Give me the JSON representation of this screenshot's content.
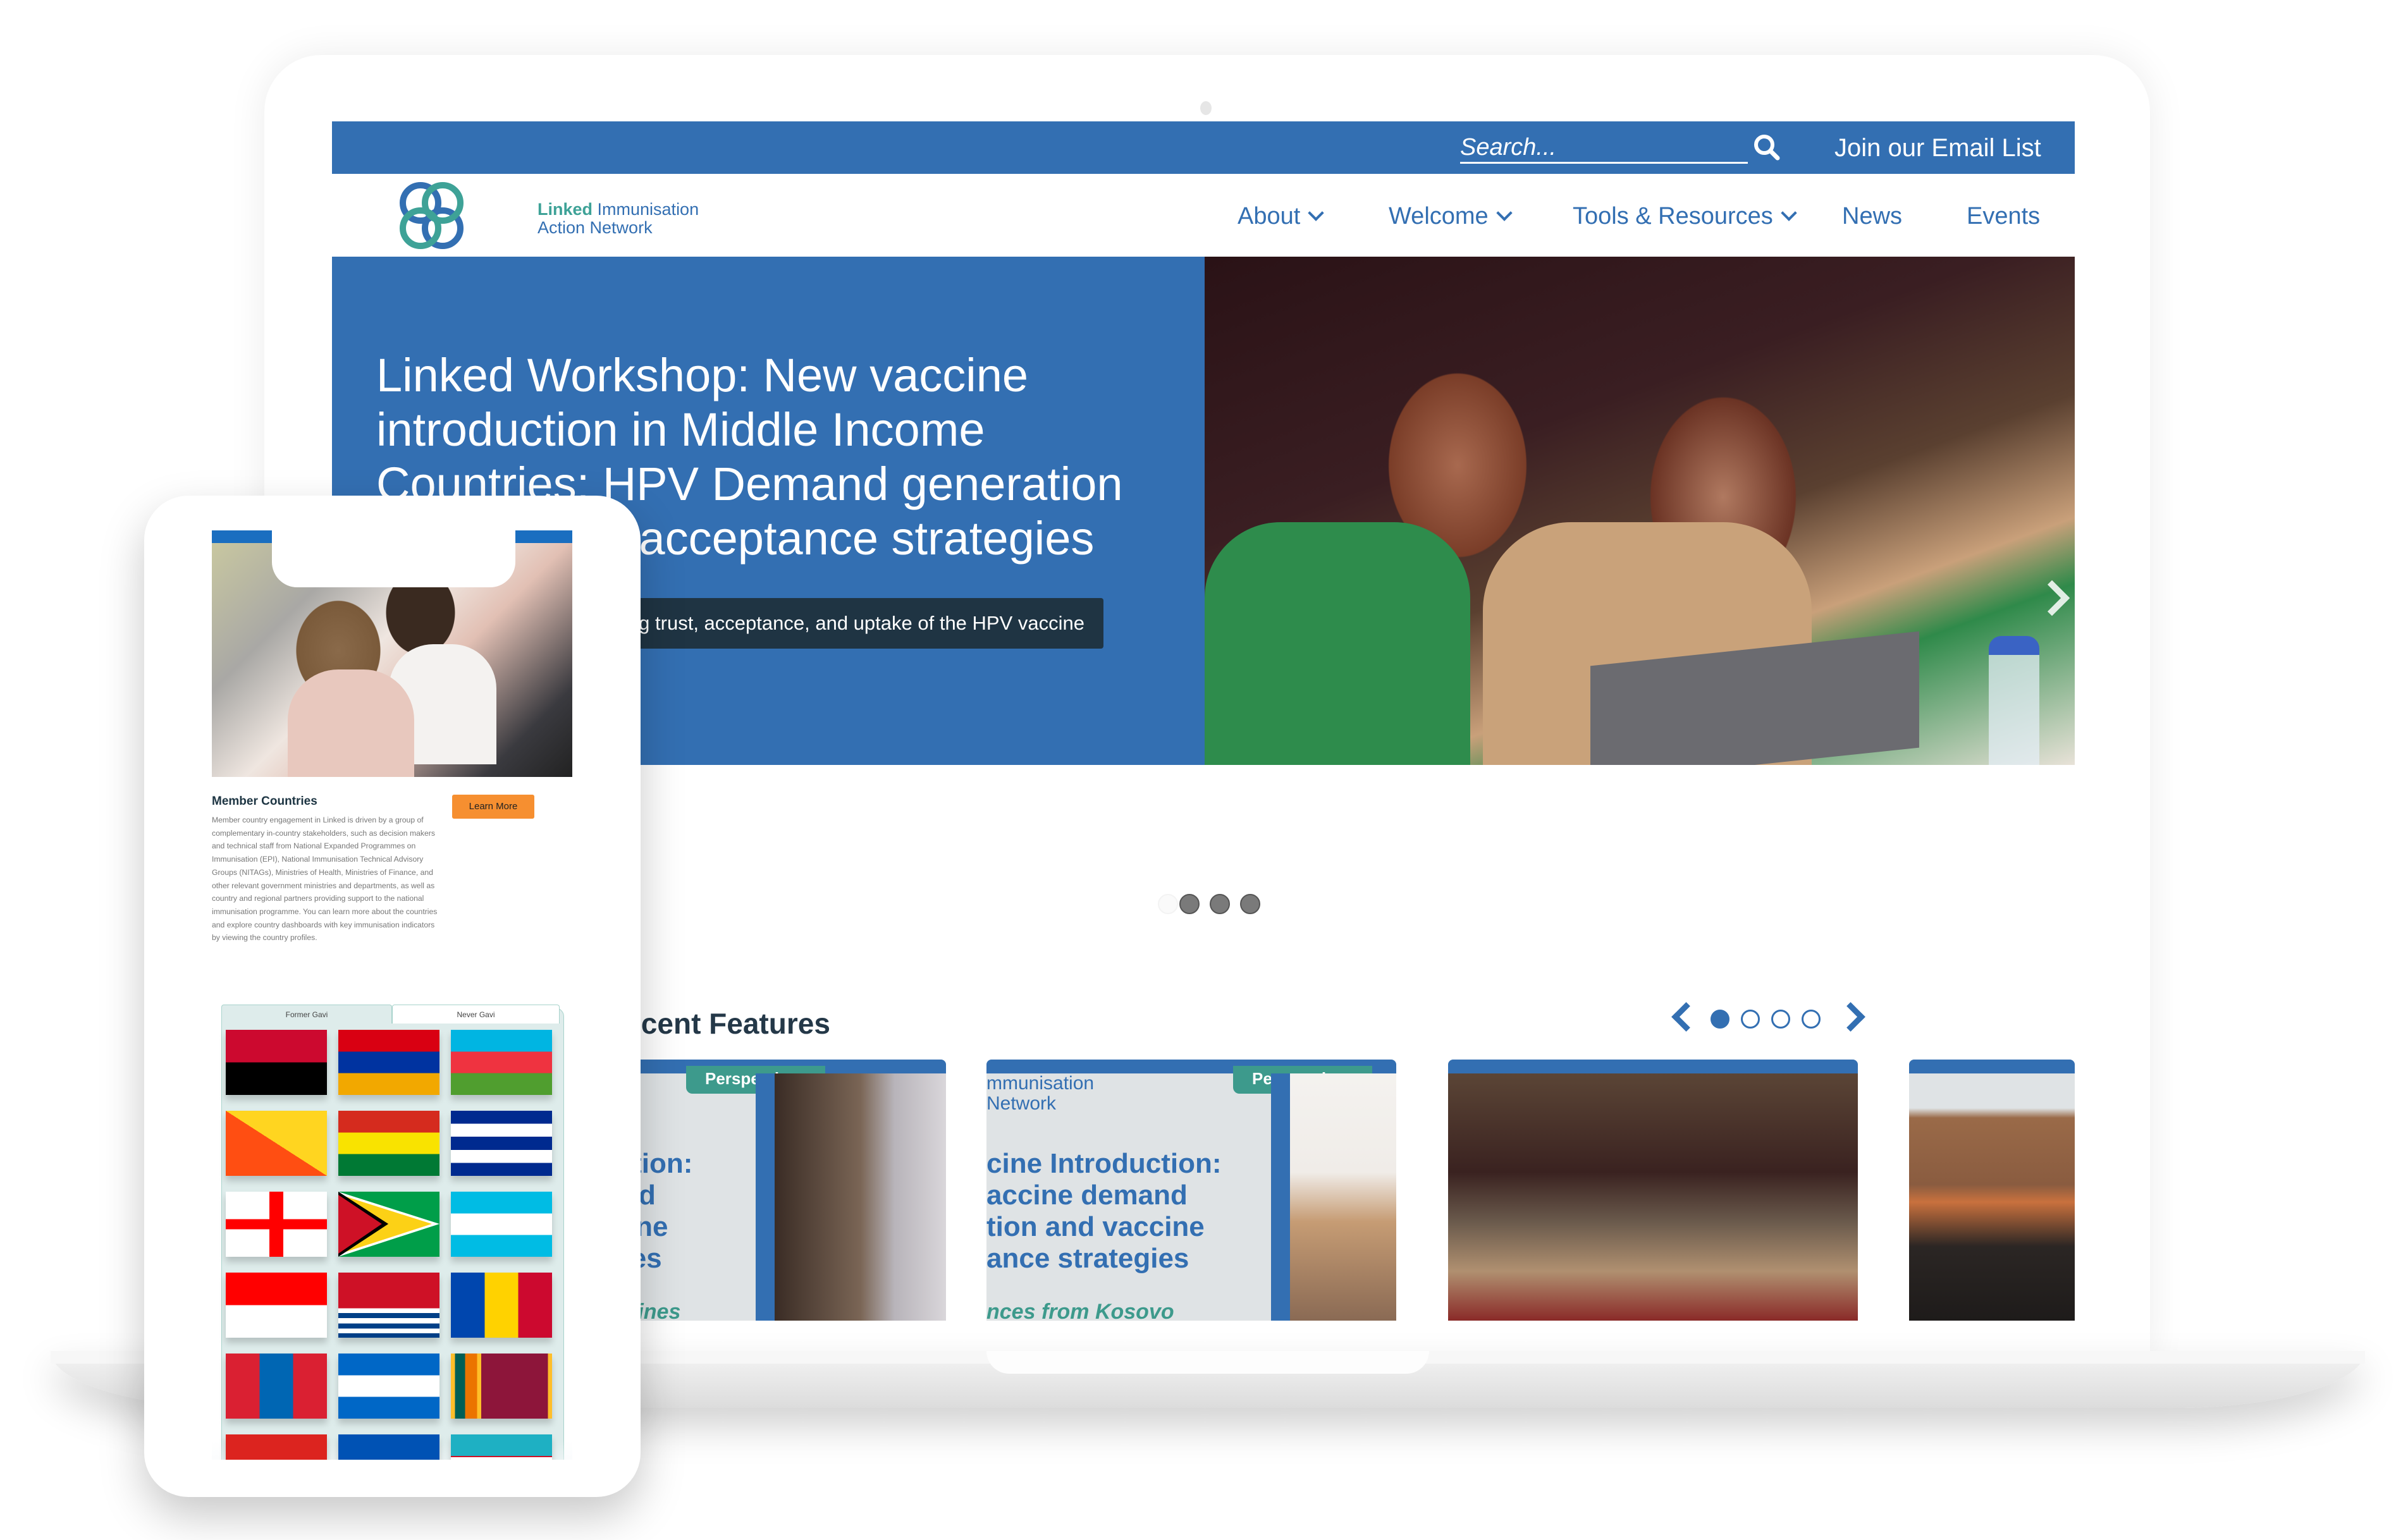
{
  "topbar": {
    "search_placeholder": "Search...",
    "search_icon": "search-icon",
    "email_link": "Join our Email List"
  },
  "logo": {
    "bold": "Linked",
    "line1_rest": "Immunisation",
    "line2": "Action Network"
  },
  "nav": {
    "items": [
      {
        "label": "About",
        "has_dropdown": true
      },
      {
        "label": "Welcome",
        "has_dropdown": true
      },
      {
        "label": "Tools & Resources",
        "has_dropdown": true
      },
      {
        "label": "News",
        "has_dropdown": false
      },
      {
        "label": "Events",
        "has_dropdown": false
      }
    ]
  },
  "hero": {
    "title": "Linked Workshop: New vaccine introduction in Middle Income Countries: HPV Demand generation and vaccine acceptance strategies",
    "caption": "Building trust, acceptance, and uptake of the HPV vaccine",
    "next_icon": "chevron-right-icon",
    "slide_count": 4,
    "active_slide": 1
  },
  "features": {
    "heading": "Recent Features",
    "page_count": 4,
    "active_page": 1,
    "cards": [
      {
        "badge": "Perspectives",
        "title": "oduction:\nemand\nvaccine\nategies",
        "subtitle": "Philippines"
      },
      {
        "org": "mmunisation\nNetwork",
        "badge": "Perspectives",
        "title": "cine Introduction:\naccine demand\ntion and vaccine\nance strategies",
        "subtitle": "nces from Kosovo"
      },
      {
        "photo": "workshop-participants-photo"
      },
      {
        "photo": "speaker-photo"
      }
    ]
  },
  "phone": {
    "member_title": "Member Countries",
    "learn_more": "Learn More",
    "member_body": "Member country engagement in Linked is driven by a group of complementary in-country stakeholders, such as decision makers and technical staff from National Expanded Programmes on Immunisation (EPI), National Immunisation Technical Advisory Groups (NITAGs), Ministries of Health, Ministries of Finance, and other relevant government ministries and departments, as well as country and regional partners providing support to the national immunisation programme. You can learn more about the countries and explore country dashboards with key immunisation indicators by viewing the country profiles.",
    "tabs": [
      {
        "label": "Former Gavi",
        "active": true
      },
      {
        "label": "Never Gavi",
        "active": false
      }
    ],
    "flags": [
      "Angola",
      "Armenia",
      "Azerbaijan",
      "Bhutan",
      "Bolivia",
      "Cuba",
      "Georgia",
      "Guyana",
      "Honduras",
      "Indonesia",
      "Kiribati",
      "Moldova",
      "Mongolia",
      "Nicaragua",
      "Sri Lanka",
      "Timor-Leste",
      "Tuvalu",
      "Uzbekistan"
    ]
  },
  "colors": {
    "brand_blue": "#336fb2",
    "brand_teal": "#3ea297",
    "caption_bg": "#1f3443",
    "cta_orange": "#f68f30",
    "heading_dark": "#243848"
  }
}
